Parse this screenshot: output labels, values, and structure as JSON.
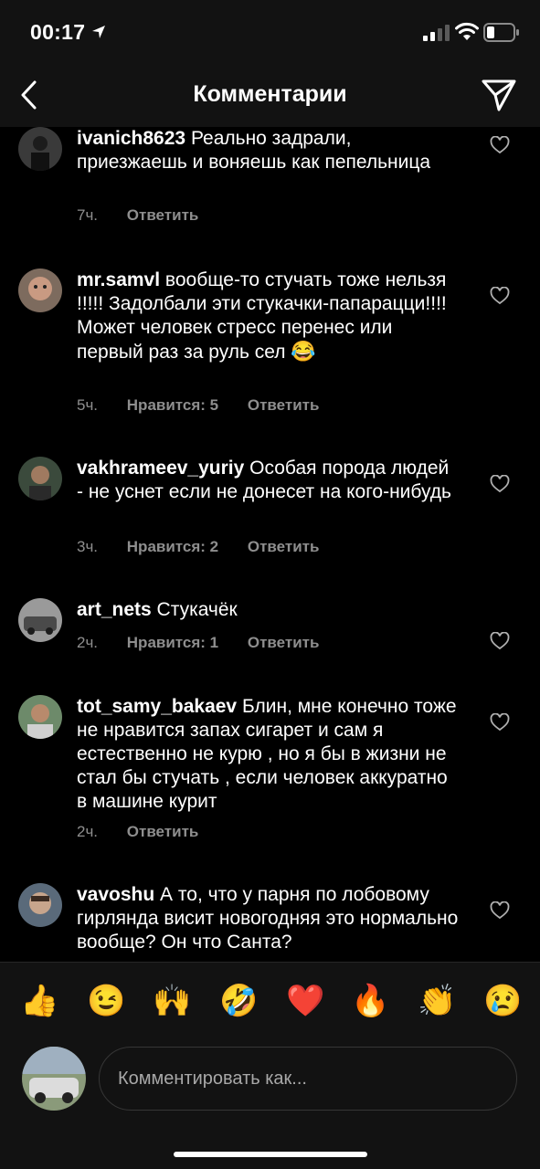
{
  "status_bar": {
    "time": "00:17"
  },
  "header": {
    "title": "Комментарии"
  },
  "comments": [
    {
      "username": "ivanich8623",
      "text": "Реально задрали, приезжаешь и воняешь как пепельница",
      "time": "7ч.",
      "likes": "",
      "reply": "Ответить"
    },
    {
      "username": "mr.samvl",
      "text": "вообще-то стучать тоже нельзя !!!!! Задолбали эти стукачки-папарацци!!!! Может человек стресс перенес или первый раз за руль сел",
      "emoji": "😂",
      "time": "5ч.",
      "likes": "Нравится: 5",
      "reply": "Ответить"
    },
    {
      "username": "vakhrameev_yuriy",
      "text": "Особая порода людей - не уснет если не донесет на кого-нибудь",
      "time": "3ч.",
      "likes": "Нравится: 2",
      "reply": "Ответить"
    },
    {
      "username": "art_nets",
      "text": "Стукачёк",
      "time": "2ч.",
      "likes": "Нравится: 1",
      "reply": "Ответить"
    },
    {
      "username": "tot_samy_bakaev",
      "text": "Блин, мне конечно тоже не нравится запах сигарет и сам я естественно не курю , но я бы в жизни не стал бы стучать , если человек аккуратно в машине курит",
      "time": "2ч.",
      "likes": "",
      "reply": "Ответить"
    },
    {
      "username": "vavoshu",
      "text": "А то, что у парня по лобовому гирлянда висит новогодняя это нормально вообще? Он что Санта?",
      "time": "",
      "likes": "",
      "reply": ""
    }
  ],
  "emoji_bar": [
    "👍",
    "😉",
    "🙌",
    "🤣",
    "❤️",
    "🔥",
    "👏",
    "😢"
  ],
  "comment_input": {
    "placeholder": "Комментировать как..."
  },
  "icons": {
    "back": "chevron-left-icon",
    "send": "paper-plane-icon",
    "like": "heart-outline-icon"
  },
  "colors": {
    "background": "#000000",
    "bar": "#121212",
    "secondary_text": "#8e8e8e"
  }
}
